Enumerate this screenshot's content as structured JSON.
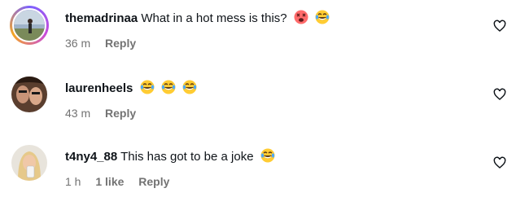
{
  "comments": [
    {
      "username": "themadrinaa",
      "text": "What in a hot mess is this?",
      "emojis": [
        "face-with-crossed-out-eyes-emoji",
        "laughing-tears-emoji"
      ],
      "time": "36 m",
      "likes": "",
      "reply_label": "Reply"
    },
    {
      "username": "laurenheels",
      "text": "",
      "emojis": [
        "laughing-tears-emoji",
        "laughing-tears-emoji",
        "laughing-tears-emoji"
      ],
      "time": "43 m",
      "likes": "",
      "reply_label": "Reply"
    },
    {
      "username": "t4ny4_88",
      "text": "This has got to be a joke",
      "emojis": [
        "laughing-tears-emoji"
      ],
      "time": "1 h",
      "likes": "1 like",
      "reply_label": "Reply"
    }
  ],
  "colors": {
    "text": "#0f1419",
    "muted": "#737373",
    "story_ring": "#c94cd9"
  }
}
